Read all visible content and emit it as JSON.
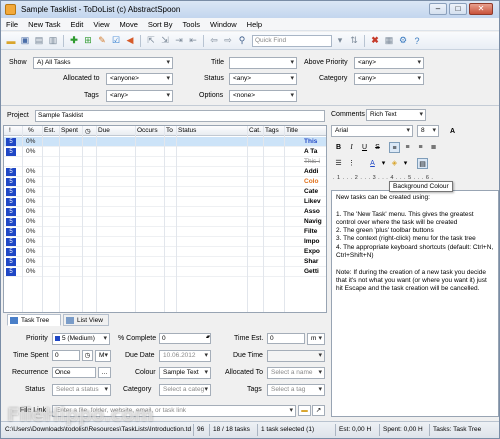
{
  "window": {
    "title": "Sample Tasklist - ToDoList (c) AbstractSpoon"
  },
  "menu": [
    "File",
    "New Task",
    "Edit",
    "View",
    "Move",
    "Sort By",
    "Tools",
    "Window",
    "Help"
  ],
  "toolbar": {
    "quickfind_placeholder": "Quick Find"
  },
  "filters": {
    "show_label": "Show",
    "show_value": "A)  All Tasks",
    "title_label": "Title",
    "title_value": "",
    "above_priority_label": "Above Priority",
    "above_priority_value": "<any>",
    "allocated_to_label": "Allocated to",
    "allocated_to_value": "<anyone>",
    "status_label": "Status",
    "status_value": "<any>",
    "category_label": "Category",
    "category_value": "<any>",
    "tags_label": "Tags",
    "tags_value": "<any>",
    "options_label": "Options",
    "options_value": "<none>"
  },
  "project": {
    "label": "Project",
    "value": "Sample Tasklist"
  },
  "tree": {
    "columns": [
      "!",
      "%",
      "Est.",
      "Spent",
      "Due",
      "Occurs",
      "To",
      "Status",
      "Cat.",
      "Tags",
      "Title"
    ],
    "rows": [
      {
        "prio": "5",
        "pct": "0%",
        "title": "This",
        "color": "#1f47c5",
        "selected": true
      },
      {
        "prio": "5",
        "pct": "0%",
        "title": "A Ta",
        "color": "#000000"
      },
      {
        "prio": "",
        "pct": "",
        "title": "This-i",
        "color": "#8a8a8a"
      },
      {
        "prio": "5",
        "pct": "0%",
        "title": "Addi",
        "color": "#000000"
      },
      {
        "prio": "5",
        "pct": "0%",
        "title": "Colo",
        "color": "#e0701a"
      },
      {
        "prio": "5",
        "pct": "0%",
        "title": "Cate",
        "color": "#000000"
      },
      {
        "prio": "5",
        "pct": "0%",
        "title": "Likev",
        "color": "#000000"
      },
      {
        "prio": "5",
        "pct": "0%",
        "title": "Asso",
        "color": "#000000"
      },
      {
        "prio": "5",
        "pct": "0%",
        "title": "Navig",
        "color": "#000000"
      },
      {
        "prio": "5",
        "pct": "0%",
        "title": "Filte",
        "color": "#000000"
      },
      {
        "prio": "5",
        "pct": "0%",
        "title": "Impo",
        "color": "#000000"
      },
      {
        "prio": "5",
        "pct": "0%",
        "title": "Expo",
        "color": "#000000"
      },
      {
        "prio": "5",
        "pct": "0%",
        "title": "Shar",
        "color": "#000000"
      },
      {
        "prio": "5",
        "pct": "0%",
        "title": "Getti",
        "color": "#000000"
      }
    ]
  },
  "tabs": {
    "tree": "Task Tree",
    "list": "List View"
  },
  "attributes": {
    "priority_label": "Priority",
    "priority_value": "5 (Medium)",
    "complete_label": "% Complete",
    "complete_value": "0",
    "timeest_label": "Time Est.",
    "timeest_value": "0",
    "timeest_unit": "m",
    "timespent_label": "Time Spent",
    "timespent_value": "0",
    "timespent_unit": "M",
    "duedate_label": "Due Date",
    "duedate_value": "10.06.2012",
    "duetime_label": "Due Time",
    "recurrence_label": "Recurrence",
    "recurrence_value": "Once",
    "colour_label": "Colour",
    "colour_value": "Sample Text",
    "allocated_label": "Allocated To",
    "allocated_placeholder": "Select a name",
    "status_label": "Status",
    "status_placeholder": "Select a status",
    "category_label": "Category",
    "category_placeholder": "Select a categ",
    "tags_label": "Tags",
    "tags_placeholder": "Select a tag",
    "filelink_label": "File Link",
    "filelink_placeholder": "Enter a file, folder, website, email, or task link"
  },
  "comments": {
    "label": "Comments",
    "format": "Rich Text",
    "font": "Arial",
    "size": "8",
    "tooltip": "Background Colour",
    "ruler": ". 1 . . . 2 . . . 3 . . . 4 . . . 5 . . . 6 .",
    "body": [
      "New tasks can be created using:",
      "",
      "1. The 'New Task' menu. This gives the greatest control over where the task will be created",
      "2. The green 'plus' toolbar buttons",
      "3. The context (right-click) menu for the task tree",
      "4. The appropriate keyboard shortcuts (default: Ctrl+N, Ctrl+Shift+N)",
      "",
      "Note: If during the creation of a new task you decide that it's not what you want (or where you want it) just hit Escape and the task creation will be cancelled."
    ]
  },
  "status": {
    "path": "C:\\Users\\Downloads\\todolist\\Resources\\TaskLists\\Introduction.tdl",
    "lines": "96",
    "tasks": "18 / 18 tasks",
    "selected": "1 task selected (1)",
    "est": "Est: 0,00 H",
    "spent": "Spent: 0,00 H",
    "view": "Tasks: Task Tree"
  },
  "watermark": "FileHippo.com"
}
